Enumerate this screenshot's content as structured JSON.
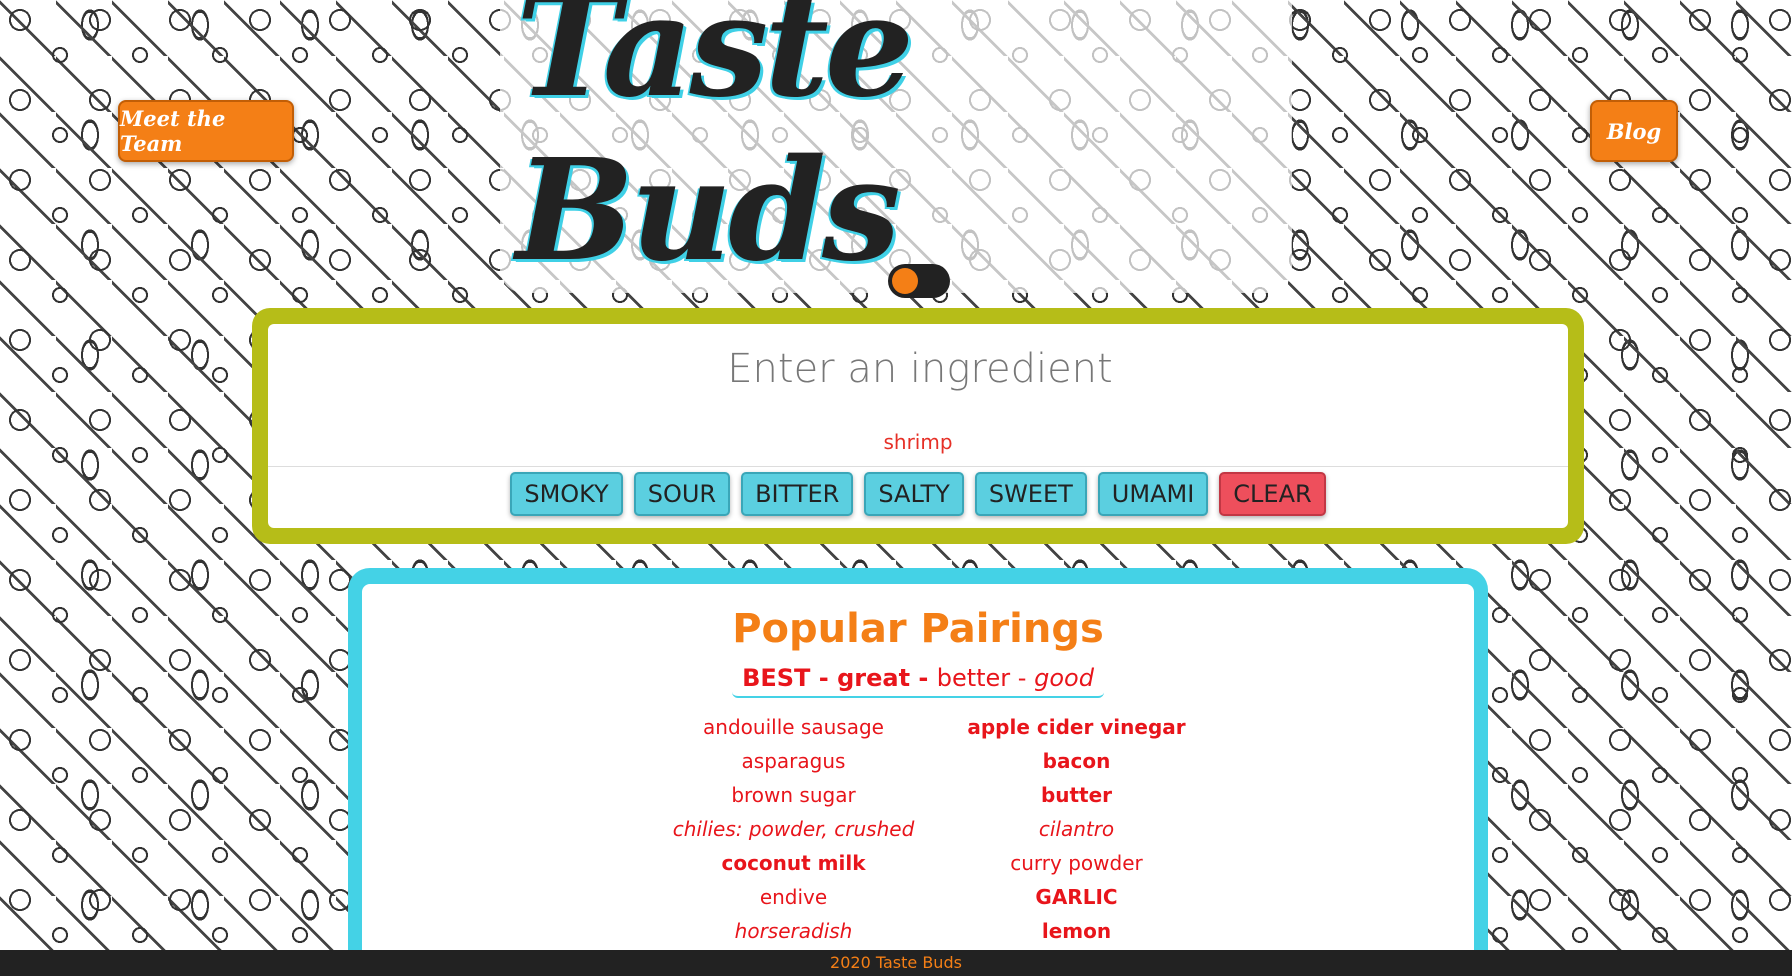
{
  "nav": {
    "team_label": "Meet the Team",
    "blog_label": "Blog"
  },
  "logo": {
    "text": "Taste Buds"
  },
  "search": {
    "placeholder": "Enter an ingredient",
    "value": "",
    "selected_ingredient": "shrimp"
  },
  "flavors": [
    "SMOKY",
    "SOUR",
    "BITTER",
    "SALTY",
    "SWEET",
    "UMAMI"
  ],
  "clear_label": "CLEAR",
  "pairings": {
    "title": "Popular Pairings",
    "legend": {
      "best": "BEST",
      "sep1": " - ",
      "great": "great",
      "sep2": " - ",
      "better": "better",
      "sep3": " - ",
      "good": "good"
    },
    "items": [
      {
        "name": "andouille sausage",
        "tier": "better"
      },
      {
        "name": "apple cider vinegar",
        "tier": "great"
      },
      {
        "name": "asparagus",
        "tier": "better"
      },
      {
        "name": "bacon",
        "tier": "great"
      },
      {
        "name": "brown sugar",
        "tier": "better"
      },
      {
        "name": "butter",
        "tier": "great"
      },
      {
        "name": "chilies: powder, crushed",
        "tier": "good"
      },
      {
        "name": "cilantro",
        "tier": "good"
      },
      {
        "name": "coconut milk",
        "tier": "great"
      },
      {
        "name": "curry powder",
        "tier": "better"
      },
      {
        "name": "endive",
        "tier": "better"
      },
      {
        "name": "GARLIC",
        "tier": "best"
      },
      {
        "name": "horseradish",
        "tier": "good"
      },
      {
        "name": "lemon",
        "tier": "great"
      }
    ]
  },
  "footer": {
    "text": "2020 Taste Buds"
  },
  "colors": {
    "accent_orange": "#f47f16",
    "panel_green": "#b6bd18",
    "panel_cyan": "#44d2e6",
    "pairing_red": "#e8151b",
    "flavor_blue": "#5bcfe0",
    "clear_red": "#ee4f5c"
  }
}
